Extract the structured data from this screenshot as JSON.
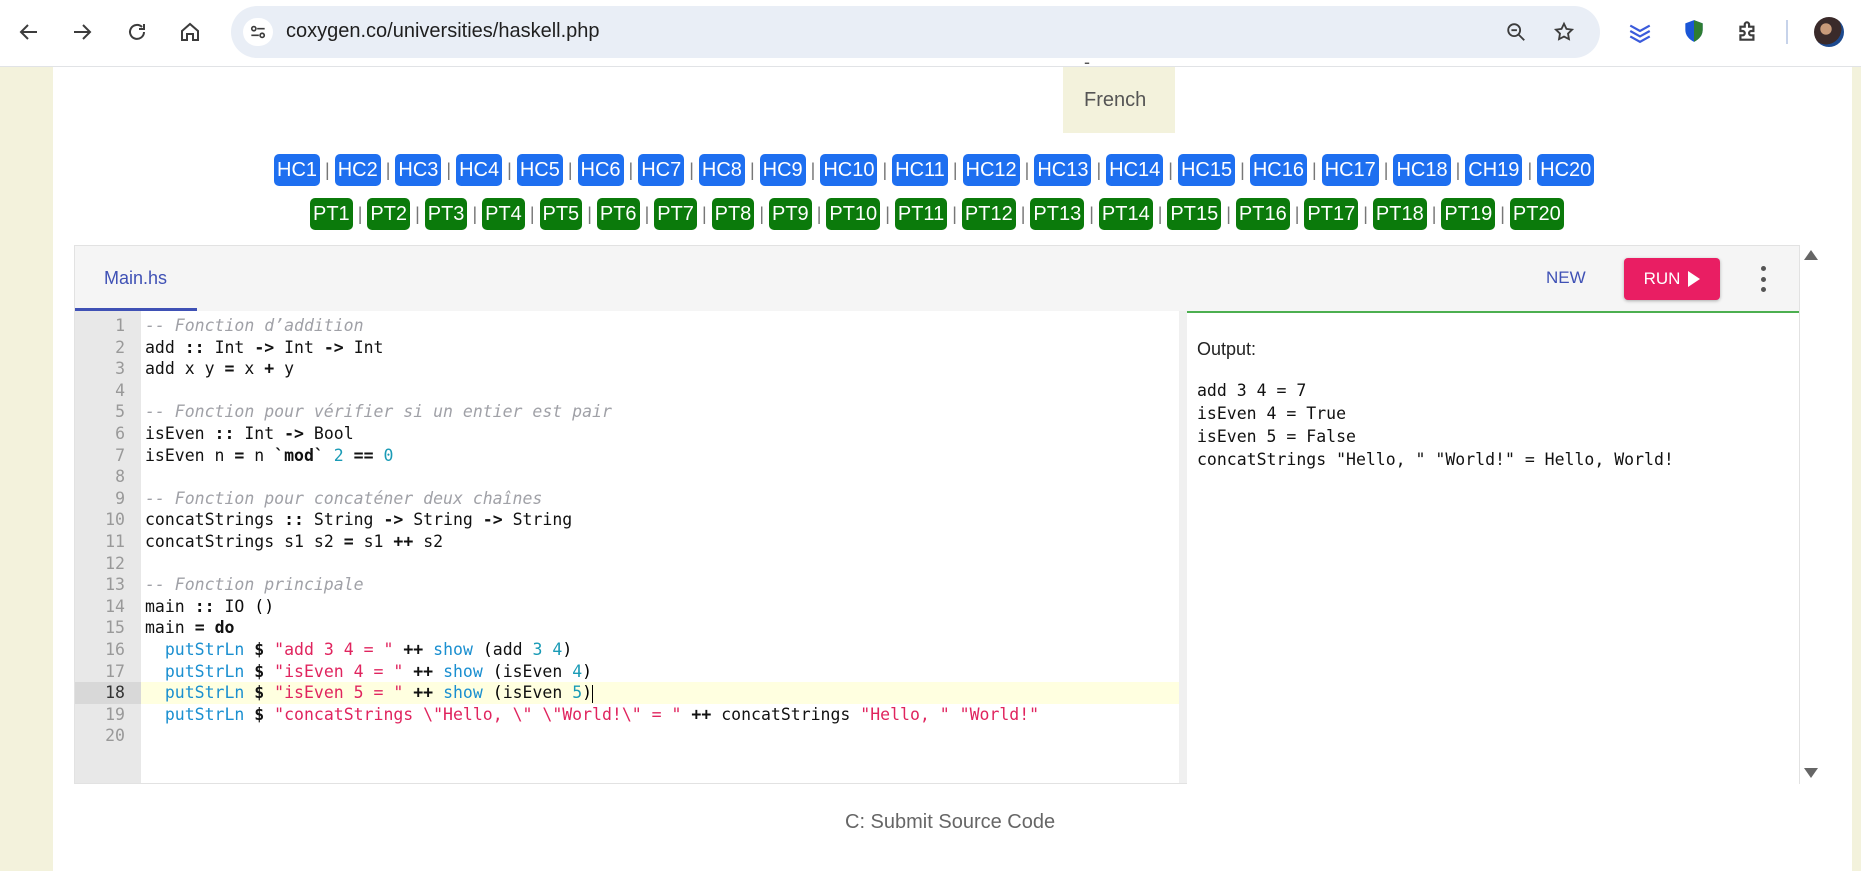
{
  "browser": {
    "url": "coxygen.co/universities/haskell.php",
    "icons": [
      "back-icon",
      "forward-icon",
      "reload-icon",
      "home-icon",
      "site-info-icon",
      "zoom-icon",
      "bookmark-star-icon",
      "extension-layers-icon",
      "shield-extension-icon",
      "puzzle-extensions-icon",
      "profile-avatar"
    ]
  },
  "page": {
    "language_dash": "-",
    "language": "French",
    "hc_buttons": [
      "HC1",
      "HC2",
      "HC3",
      "HC4",
      "HC5",
      "HC6",
      "HC7",
      "HC8",
      "HC9",
      "HC10",
      "HC11",
      "HC12",
      "HC13",
      "HC14",
      "HC15",
      "HC16",
      "HC17",
      "HC18",
      "CH19",
      "HC20"
    ],
    "pt_buttons": [
      "PT1",
      "PT2",
      "PT3",
      "PT4",
      "PT5",
      "PT6",
      "PT7",
      "PT8",
      "PT9",
      "PT10",
      "PT11",
      "PT12",
      "PT13",
      "PT14",
      "PT15",
      "PT16",
      "PT17",
      "PT18",
      "PT19",
      "PT20"
    ],
    "separator": "|",
    "submit_label": "C: Submit Source Code"
  },
  "editor": {
    "tab_label": "Main.hs",
    "new_label": "NEW",
    "run_label": "RUN",
    "active_line": 18,
    "line_numbers": [
      "1",
      "2",
      "3",
      "4",
      "5",
      "6",
      "7",
      "8",
      "9",
      "10",
      "11",
      "12",
      "13",
      "14",
      "15",
      "16",
      "17",
      "18",
      "19",
      "20"
    ],
    "code_lines": [
      "-- Fonction d’addition",
      "add :: Int -> Int -> Int",
      "add x y = x + y",
      "",
      "-- Fonction pour vérifier si un entier est pair",
      "isEven :: Int -> Bool",
      "isEven n = n `mod` 2 == 0",
      "",
      "-- Fonction pour concaténer deux chaînes",
      "concatStrings :: String -> String -> String",
      "concatStrings s1 s2 = s1 ++ s2",
      "",
      "-- Fonction principale",
      "main :: IO ()",
      "main = do",
      "  putStrLn $ \"add 3 4 = \" ++ show (add 3 4)",
      "  putStrLn $ \"isEven 4 = \" ++ show (isEven 4)",
      "  putStrLn $ \"isEven 5 = \" ++ show (isEven 5)",
      "  putStrLn $ \"concatStrings \\\"Hello, \\\" \\\"World!\\\" = \" ++ concatStrings \"Hello, \" \"World!\"",
      ""
    ]
  },
  "output": {
    "title": "Output:",
    "lines": [
      "add 3 4 = 7",
      "isEven 4 = True",
      "isEven 5 = False",
      "concatStrings \"Hello, \" \"World!\" = Hello, World!"
    ]
  },
  "colors": {
    "hc_button": "#1e6ff0",
    "pt_button": "#0b7a0b",
    "run_button": "#e91e63",
    "tab_accent": "#3f51b5",
    "output_border": "#4caf50"
  }
}
